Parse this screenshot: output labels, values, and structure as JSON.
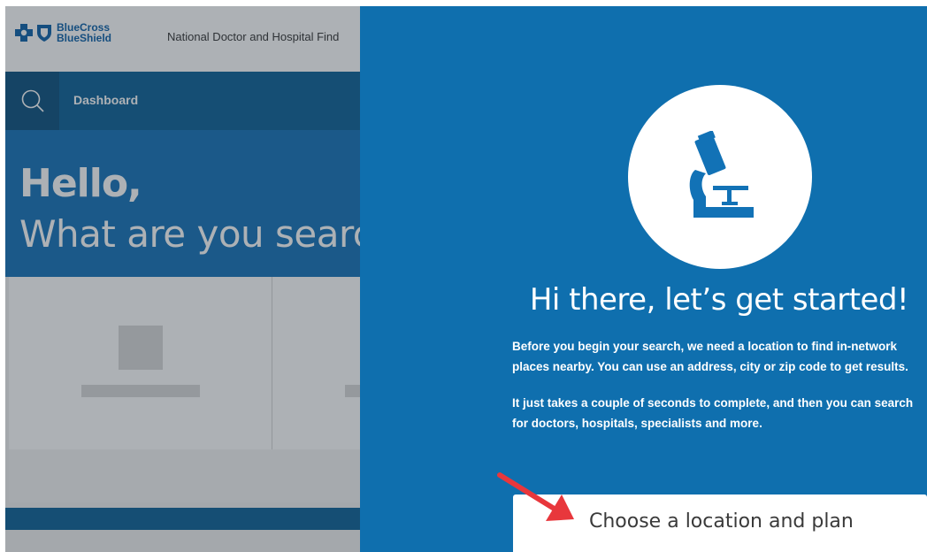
{
  "brand": {
    "line1": "BlueCross",
    "line2": "BlueShield",
    "color": "#0b5fa8"
  },
  "header": {
    "finder_title": "National Doctor and Hospital Find"
  },
  "nav": {
    "search_icon": "search-icon",
    "dashboard_label": "Dashboard"
  },
  "hero": {
    "greeting": "Hello,",
    "question": "What are you searc"
  },
  "modal": {
    "icon": "microscope-icon",
    "heading": "Hi there, let’s get started!",
    "paragraph1": "Before you begin your search, we need a location to find in-network places nearby. You can use an address, city or zip code to get results.",
    "paragraph2": "It just takes a couple of seconds to complete, and then you can search for doctors, hospitals, specialists and more.",
    "cta_label": "Choose a location and plan",
    "background_color": "#0f6fae",
    "accent_arrow_color": "#e8373c"
  }
}
